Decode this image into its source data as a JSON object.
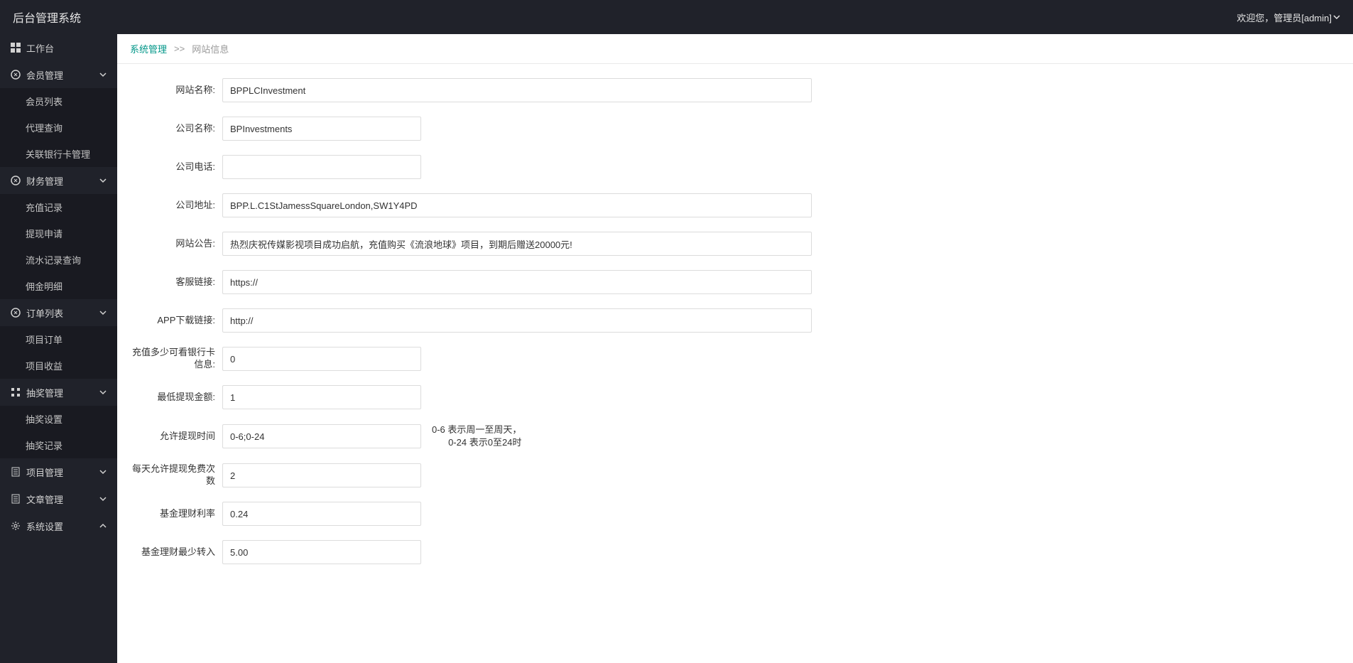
{
  "header": {
    "title": "后台管理系统",
    "welcome": "欢迎您，管理员[admin]"
  },
  "sidebar": {
    "items": [
      {
        "icon": "dashboard",
        "label": "工作台",
        "expandable": false
      },
      {
        "icon": "circle",
        "label": "会员管理",
        "expandable": true,
        "open": true,
        "children": [
          "会员列表",
          "代理查询",
          "关联银行卡管理"
        ]
      },
      {
        "icon": "circle",
        "label": "财务管理",
        "expandable": true,
        "open": true,
        "children": [
          "充值记录",
          "提现申请",
          "流水记录查询",
          "佣金明细"
        ]
      },
      {
        "icon": "circle",
        "label": "订单列表",
        "expandable": true,
        "open": true,
        "children": [
          "项目订单",
          "项目收益"
        ]
      },
      {
        "icon": "grid",
        "label": "抽奖管理",
        "expandable": true,
        "open": true,
        "children": [
          "抽奖设置",
          "抽奖记录"
        ]
      },
      {
        "icon": "doc",
        "label": "项目管理",
        "expandable": true,
        "open": false
      },
      {
        "icon": "doc",
        "label": "文章管理",
        "expandable": true,
        "open": false
      },
      {
        "icon": "gear",
        "label": "系统设置",
        "expandable": true,
        "open": false,
        "openUp": true
      }
    ]
  },
  "breadcrumb": {
    "parent": "系统管理",
    "sep": ">>",
    "current": "网站信息"
  },
  "form": {
    "site_name": {
      "label": "网站名称:",
      "value": "BPPLCInvestment"
    },
    "company_name": {
      "label": "公司名称:",
      "value": "BPInvestments"
    },
    "company_phone": {
      "label": "公司电话:",
      "value": ""
    },
    "company_address": {
      "label": "公司地址:",
      "value": "BPP.L.C1StJamessSquareLondon,SW1Y4PD"
    },
    "site_notice": {
      "label": "网站公告:",
      "value": "热烈庆祝传媒影视项目成功启航，充值购买《流浪地球》项目，到期后赠送20000元!"
    },
    "service_link": {
      "label": "客服链接:",
      "value": "https://"
    },
    "app_download": {
      "label": "APP下载链接:",
      "value": "http://"
    },
    "recharge_bank": {
      "label": "充值多少可看银行卡信息:",
      "value": "0"
    },
    "min_withdraw": {
      "label": "最低提现金额:",
      "value": "1"
    },
    "withdraw_time": {
      "label": "允许提现时间",
      "value": "0-6;0-24",
      "hint_line1": "0-6 表示周一至周天，",
      "hint_line2": "0-24 表示0至24时"
    },
    "free_withdraw_count": {
      "label": "每天允许提现免费次数",
      "value": "2"
    },
    "fund_rate": {
      "label": "基金理财利率",
      "value": "0.24"
    },
    "fund_min_transfer": {
      "label": "基金理财最少转入",
      "value": "5.00"
    }
  }
}
